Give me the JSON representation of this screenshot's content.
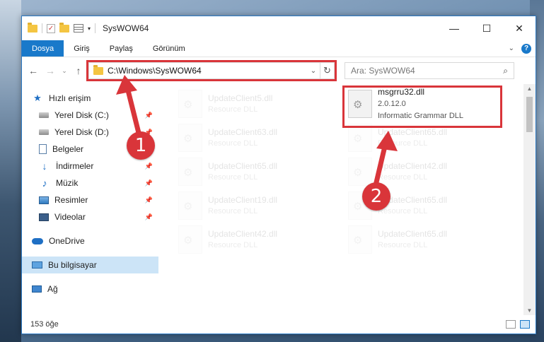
{
  "window": {
    "title": "SysWOW64",
    "controls": {
      "minimize": "—",
      "maximize": "☐",
      "close": "✕"
    }
  },
  "ribbon": {
    "tabs": [
      "Dosya",
      "Giriş",
      "Paylaş",
      "Görünüm"
    ],
    "expand": "⌄",
    "help": "?"
  },
  "nav_buttons": {
    "back": "←",
    "forward": "→",
    "recent": "⌄",
    "up": "↑"
  },
  "address": {
    "path": "C:\\Windows\\SysWOW64",
    "dropdown": "⌄",
    "refresh": "↻"
  },
  "search": {
    "placeholder": "Ara: SysWOW64",
    "icon": "search-icon"
  },
  "sidebar": {
    "quick_access": "Hızlı erişim",
    "items": [
      {
        "label": "Yerel Disk (C:)",
        "icon": "disk-icon",
        "pinned": true
      },
      {
        "label": "Yerel Disk (D:)",
        "icon": "disk-icon",
        "pinned": true
      },
      {
        "label": "Belgeler",
        "icon": "document-icon",
        "pinned": true
      },
      {
        "label": "İndirmeler",
        "icon": "download-icon",
        "pinned": true
      },
      {
        "label": "Müzik",
        "icon": "music-icon",
        "pinned": true
      },
      {
        "label": "Resimler",
        "icon": "pictures-icon",
        "pinned": true
      },
      {
        "label": "Videolar",
        "icon": "video-icon",
        "pinned": true
      }
    ],
    "onedrive": "OneDrive",
    "this_pc": "Bu bilgisayar",
    "network": "Ağ"
  },
  "files": {
    "faded": [
      {
        "name": "UpdateClient5.dll",
        "type": "Resource DLL"
      },
      {
        "name": "UpdateClient63.dll",
        "type": "Resource DLL"
      },
      {
        "name": "UpdateClient65.dll",
        "type": "Resource DLL"
      },
      {
        "name": "UpdateClient65.dll",
        "type": "Resource DLL"
      },
      {
        "name": "UpdateClient42.dll",
        "type": "Resource DLL"
      },
      {
        "name": "UpdateClient19.dll",
        "type": "Resource DLL"
      },
      {
        "name": "UpdateClient65.dll",
        "type": "Resource DLL"
      },
      {
        "name": "UpdateClient42.dll",
        "type": "Resource DLL"
      },
      {
        "name": "UpdateClient65.dll",
        "type": "Resource DLL"
      }
    ],
    "target": {
      "name": "msgrru32.dll",
      "version": "2.0.12.0",
      "description": "Informatic Grammar DLL"
    }
  },
  "status": {
    "count": "153 öğe"
  },
  "annotations": {
    "step1": "1",
    "step2": "2",
    "color": "#d9353a"
  }
}
